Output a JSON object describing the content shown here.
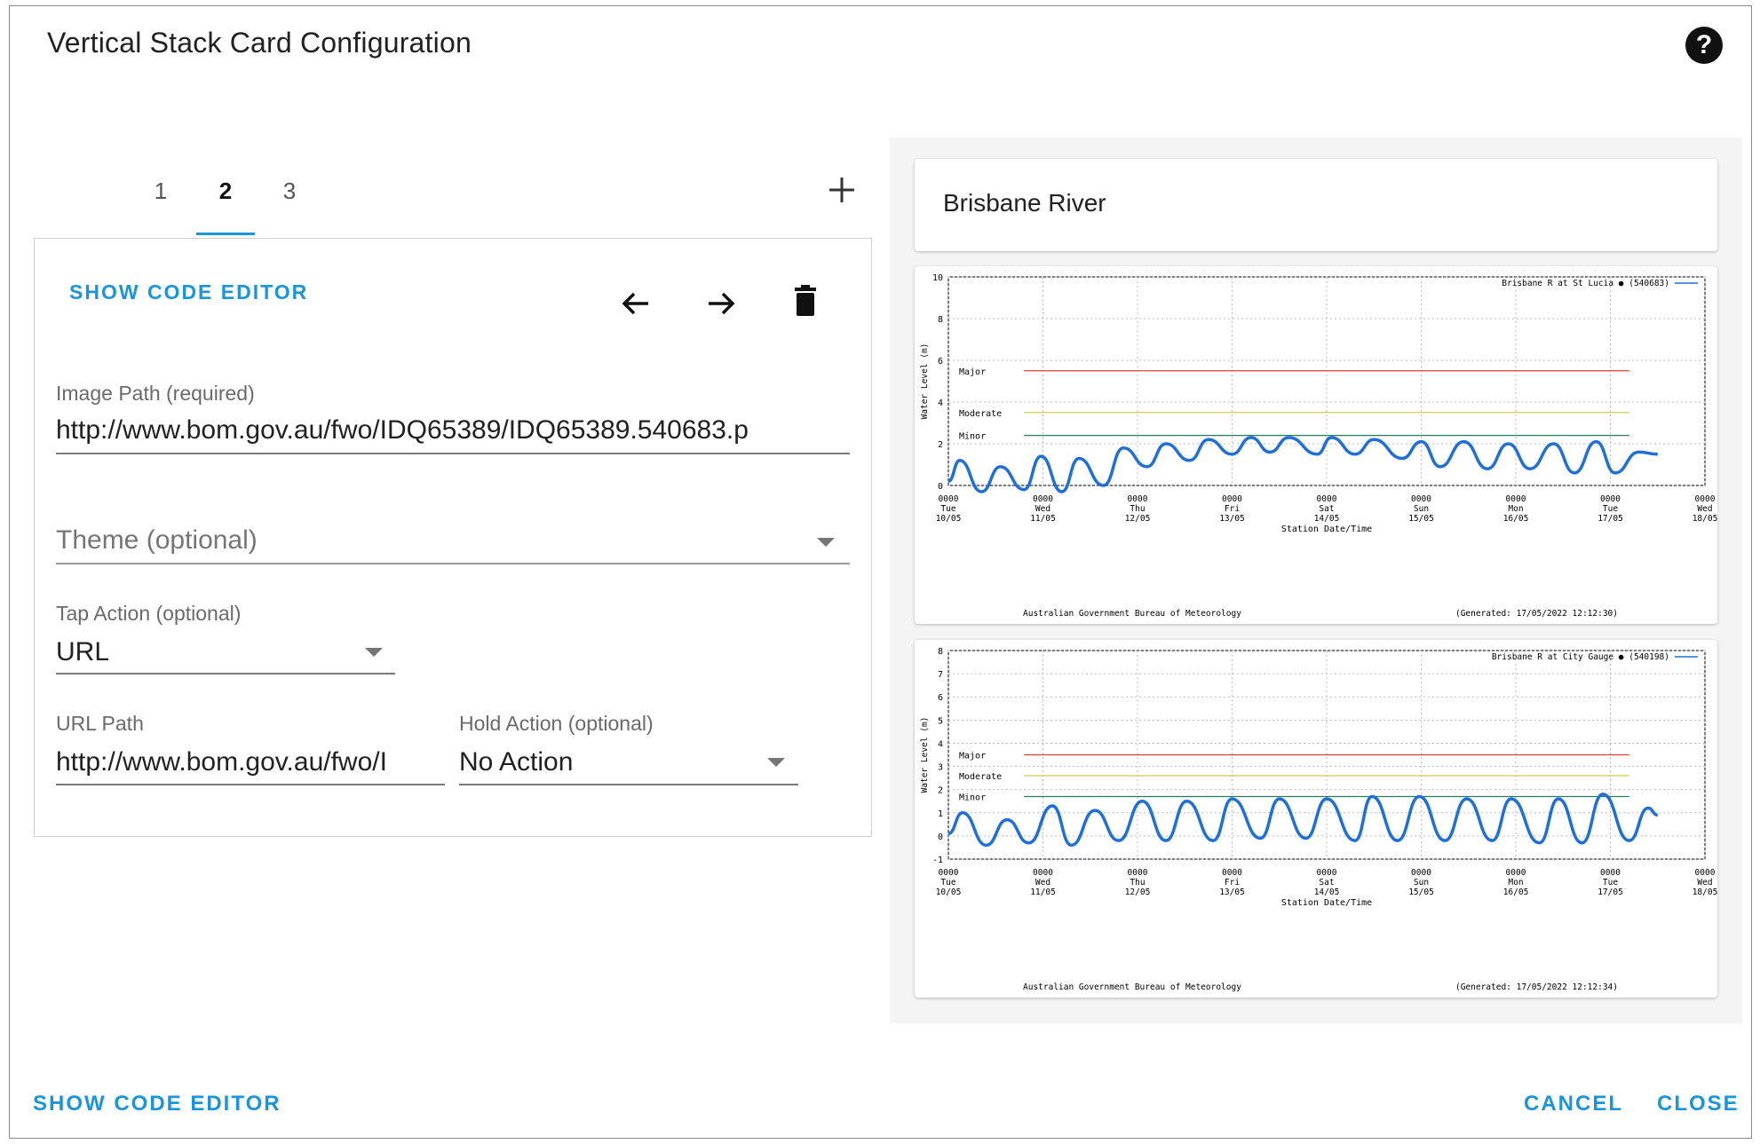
{
  "dialog": {
    "title": "Vertical Stack Card Configuration",
    "help_icon": "help-circle-icon"
  },
  "tabs": [
    "1",
    "2",
    "3"
  ],
  "active_tab": "2",
  "editor": {
    "show_code_editor": "SHOW CODE EDITOR",
    "image_path_label": "Image Path (required)",
    "image_path_value": "http://www.bom.gov.au/fwo/IDQ65389/IDQ65389.540683.p",
    "theme_placeholder": "Theme (optional)",
    "tap_action_label": "Tap Action (optional)",
    "tap_action_value": "URL",
    "url_path_label": "URL Path",
    "url_path_value": "http://www.bom.gov.au/fwo/I",
    "hold_action_label": "Hold Action (optional)",
    "hold_action_value": "No Action"
  },
  "preview": {
    "card_title": "Brisbane River"
  },
  "footer": {
    "show_code_editor": "SHOW CODE EDITOR",
    "cancel": "CANCEL",
    "close": "CLOSE"
  },
  "colors": {
    "accent": "#1a94db",
    "major": "#e03c3c",
    "moderate": "#d8c84a",
    "minor": "#2a7a5a",
    "series": "#1e6fd9"
  },
  "chart_data": [
    {
      "type": "line",
      "legend": "Brisbane R at St Lucia ● (540683)",
      "ylabel": "Water Level (m)",
      "xlabel": "Station Date/Time",
      "ylim": [
        0,
        10
      ],
      "yticks": [
        "0",
        "2",
        "4",
        "6",
        "8",
        "10"
      ],
      "xticks": [
        [
          "0000",
          "Tue",
          "10/05"
        ],
        [
          "0000",
          "Wed",
          "11/05"
        ],
        [
          "0000",
          "Thu",
          "12/05"
        ],
        [
          "0000",
          "Fri",
          "13/05"
        ],
        [
          "0000",
          "Sat",
          "14/05"
        ],
        [
          "0000",
          "Sun",
          "15/05"
        ],
        [
          "0000",
          "Mon",
          "16/05"
        ],
        [
          "0000",
          "Tue",
          "17/05"
        ],
        [
          "0000",
          "Wed",
          "18/05"
        ]
      ],
      "thresholds": [
        {
          "name": "Major",
          "value": 5.5
        },
        {
          "name": "Moderate",
          "value": 3.5
        },
        {
          "name": "Minor",
          "value": 2.4
        }
      ],
      "footer_left": "Australian Government Bureau of Meteorology",
      "footer_right": "(Generated: 17/05/2022 12:12:30)",
      "series": {
        "x_days": [
          0.0,
          0.12,
          0.35,
          0.55,
          0.8,
          0.98,
          1.2,
          1.38,
          1.64,
          1.85,
          2.1,
          2.3,
          2.55,
          2.75,
          3.0,
          3.2,
          3.4,
          3.6,
          3.9,
          4.05,
          4.3,
          4.5,
          4.8,
          5.0,
          5.2,
          5.45,
          5.7,
          5.92,
          6.15,
          6.4,
          6.62,
          6.85,
          7.05,
          7.3,
          7.5
        ],
        "y": [
          0.2,
          1.2,
          -0.3,
          0.9,
          -0.2,
          1.4,
          -0.3,
          1.3,
          0.0,
          1.8,
          0.9,
          2.0,
          1.2,
          2.2,
          1.5,
          2.3,
          1.6,
          2.3,
          1.5,
          2.3,
          1.5,
          2.2,
          1.3,
          2.1,
          0.9,
          2.1,
          0.8,
          2.0,
          0.8,
          2.0,
          0.6,
          2.1,
          0.6,
          1.6,
          1.5
        ]
      }
    },
    {
      "type": "line",
      "legend": "Brisbane R at City Gauge ● (540198)",
      "ylabel": "Water Level (m)",
      "xlabel": "Station Date/Time",
      "ylim": [
        -1,
        8
      ],
      "yticks": [
        "-1",
        "0",
        "1",
        "2",
        "3",
        "4",
        "5",
        "6",
        "7",
        "8"
      ],
      "xticks": [
        [
          "0000",
          "Tue",
          "10/05"
        ],
        [
          "0000",
          "Wed",
          "11/05"
        ],
        [
          "0000",
          "Thu",
          "12/05"
        ],
        [
          "0000",
          "Fri",
          "13/05"
        ],
        [
          "0000",
          "Sat",
          "14/05"
        ],
        [
          "0000",
          "Sun",
          "15/05"
        ],
        [
          "0000",
          "Mon",
          "16/05"
        ],
        [
          "0000",
          "Tue",
          "17/05"
        ],
        [
          "0000",
          "Wed",
          "18/05"
        ]
      ],
      "thresholds": [
        {
          "name": "Major",
          "value": 3.5
        },
        {
          "name": "Moderate",
          "value": 2.6
        },
        {
          "name": "Minor",
          "value": 1.7
        }
      ],
      "footer_left": "Australian Government Bureau of Meteorology",
      "footer_right": "(Generated: 17/05/2022 12:12:34)",
      "series": {
        "x_days": [
          0.0,
          0.15,
          0.4,
          0.62,
          0.85,
          1.1,
          1.3,
          1.55,
          1.8,
          2.05,
          2.3,
          2.52,
          2.8,
          3.0,
          3.3,
          3.5,
          3.78,
          4.0,
          4.3,
          4.48,
          4.75,
          4.98,
          5.25,
          5.48,
          5.75,
          5.95,
          6.25,
          6.45,
          6.7,
          6.92,
          7.2,
          7.4,
          7.5
        ],
        "y": [
          0.1,
          1.0,
          -0.4,
          0.7,
          -0.3,
          1.3,
          -0.4,
          1.1,
          -0.2,
          1.5,
          -0.2,
          1.5,
          -0.2,
          1.6,
          -0.1,
          1.6,
          -0.1,
          1.6,
          -0.2,
          1.7,
          -0.2,
          1.7,
          -0.2,
          1.6,
          -0.2,
          1.6,
          -0.3,
          1.6,
          -0.3,
          1.8,
          -0.2,
          1.2,
          0.9
        ]
      }
    }
  ]
}
